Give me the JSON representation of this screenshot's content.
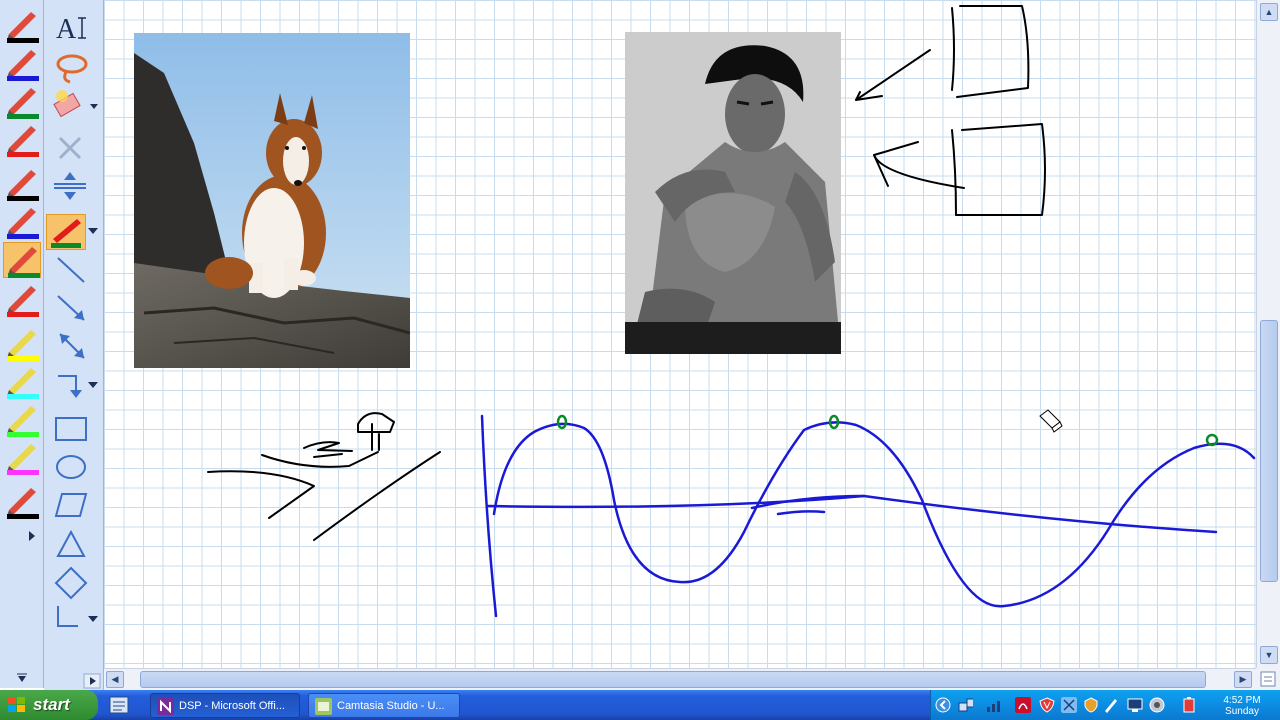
{
  "taskbar": {
    "start_label": "start",
    "tasks": [
      {
        "label": "DSP - Microsoft Offi...",
        "active": true
      },
      {
        "label": "Camtasia Studio - U...",
        "active": false
      }
    ],
    "clock_time": "4:52 PM",
    "clock_day": "Sunday"
  },
  "toolbar": {
    "text_tool_label": "A"
  },
  "colors": {
    "palette_bg": "#d4e2f7",
    "ink_black": "#000000",
    "ink_blue": "#1a1ad6",
    "ink_green": "#0a8a2a",
    "grid_line": "#c9dcee",
    "active_tool": "#f7c36a"
  },
  "pens": [
    {
      "name": "black-pen-icon",
      "color": "#000000"
    },
    {
      "name": "blue-pen-icon",
      "color": "#1a1ad6"
    },
    {
      "name": "green-pen-icon",
      "color": "#0a8a2a"
    },
    {
      "name": "red-pen-icon",
      "color": "#e21b1b"
    },
    {
      "name": "black-pen-icon",
      "color": "#000000"
    },
    {
      "name": "blue-pen-icon",
      "color": "#1a1ad6"
    },
    {
      "name": "green-pen-icon",
      "color": "#0a8a2a"
    },
    {
      "name": "red-pen-icon",
      "color": "#e21b1b"
    },
    {
      "name": "yellow-highlighter-icon",
      "color": "#ffff00"
    },
    {
      "name": "cyan-highlighter-icon",
      "color": "#33ffff"
    },
    {
      "name": "green-highlighter-icon",
      "color": "#33ff33"
    },
    {
      "name": "magenta-highlighter-icon",
      "color": "#ff33ff"
    },
    {
      "name": "black-pen-icon",
      "color": "#000000"
    }
  ],
  "tools": [
    "text-tool-icon",
    "lasso-select-icon",
    "eraser-icon",
    "delete-icon",
    "insert-space-icon",
    "active-pen-icon",
    "line-icon",
    "arrow-icon",
    "double-arrow-icon",
    "connector-icon",
    "rectangle-icon",
    "ellipse-icon",
    "parallelogram-icon",
    "triangle-icon",
    "diamond-icon",
    "axes-icon"
  ]
}
